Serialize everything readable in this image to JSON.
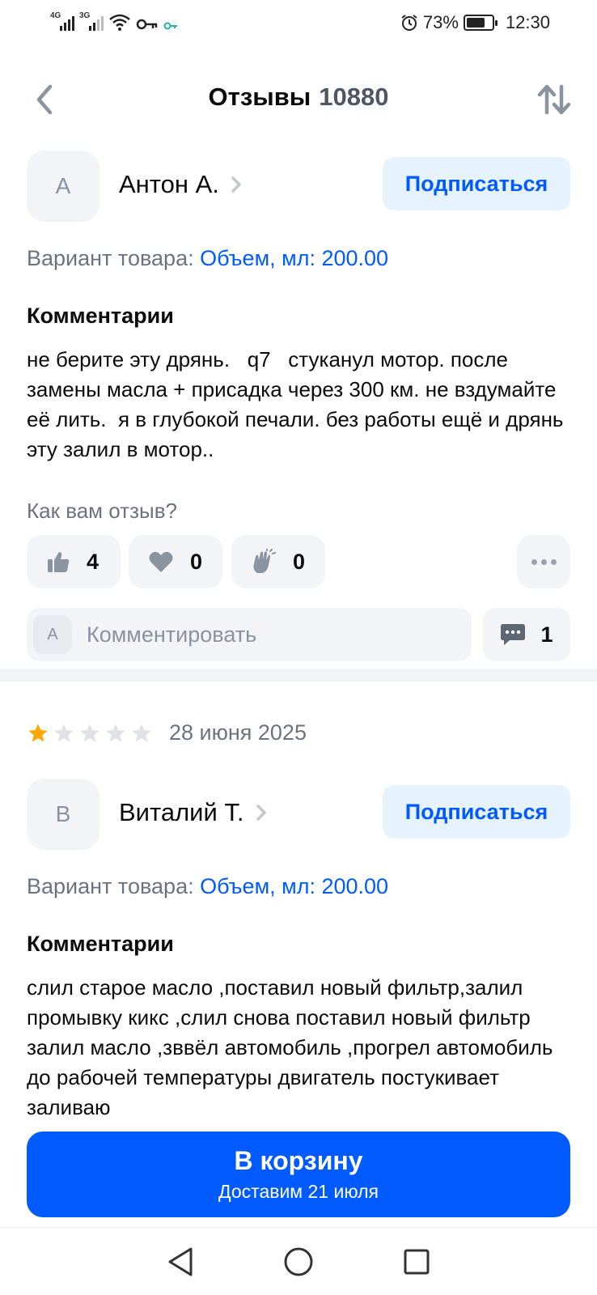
{
  "status_bar": {
    "network1": "4G",
    "network2": "3G",
    "battery": "73%",
    "battery_level": 0.73,
    "time": "12:30"
  },
  "header": {
    "title": "Отзывы",
    "count": "10880"
  },
  "reviews": [
    {
      "avatar_letter": "А",
      "author": "Антон А.",
      "subscribe_label": "Подписаться",
      "variant_label": "Вариант товара:",
      "variant_value": "Объем, мл: 200.00",
      "comments_title": "Комментарии",
      "comment": "не берите эту дрянь.   q7   стуканул мотор. после замены масла + присадка через 300 км. не вздумайте её лить.  я в глубокой печали. без работы ещё и дрянь эту залил в мотор..",
      "ask": "Как вам отзыв?",
      "likes": "4",
      "hearts": "0",
      "claps": "0",
      "my_avatar_letter": "А",
      "comment_placeholder": "Комментировать",
      "comments_count": "1"
    },
    {
      "rating": 1,
      "rating_max": 5,
      "date": "28 июня 2025",
      "avatar_letter": "В",
      "author": "Виталий Т.",
      "subscribe_label": "Подписаться",
      "variant_label": "Вариант товара:",
      "variant_value": "Объем, мл: 200.00",
      "comments_title": "Комментарии",
      "comment": "слил старое масло ,поставил новый фильтр,залил промывку кикс ,слил снова поставил новый фильтр залил масло ,зввёл автомобиль ,прогрел автомобиль до рабочей температуры двигатель постукивает заливаю"
    }
  ],
  "cart": {
    "label": "В корзину",
    "delivery": "Доставим 21 июля"
  },
  "colors": {
    "accent": "#005bff",
    "star": "#ffa800",
    "star_empty": "#dfe3e8"
  }
}
